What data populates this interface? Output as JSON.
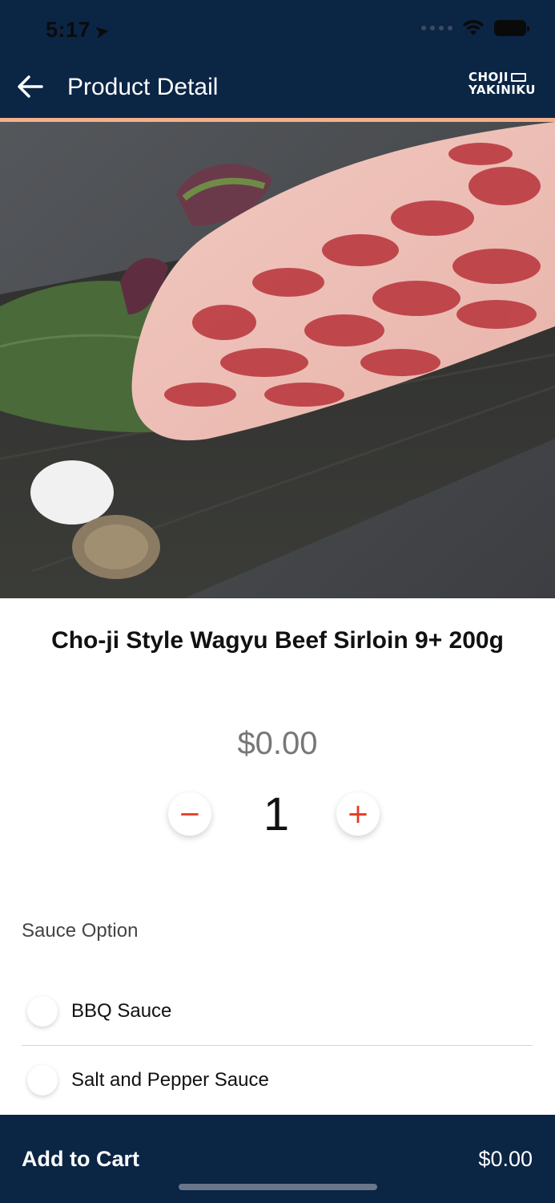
{
  "status_bar": {
    "time": "5:17"
  },
  "header": {
    "title": "Product Detail",
    "brand_line1": "CHOJI",
    "brand_line2": "YAKINIKU"
  },
  "colors": {
    "navy": "#0b2544",
    "accent": "#f4b08c",
    "stepper_red": "#e23b22"
  },
  "product": {
    "image_icon": "product-photo",
    "name": "Cho-ji Style Wagyu Beef Sirloin 9+ 200g",
    "price": "$0.00",
    "quantity": "1",
    "minus_symbol": "−",
    "plus_symbol": "+"
  },
  "sauce": {
    "label": "Sauce Option",
    "options": [
      {
        "label": "BBQ Sauce",
        "selected": false
      },
      {
        "label": "Salt and Pepper Sauce",
        "selected": false
      }
    ]
  },
  "cart": {
    "label": "Add to Cart",
    "total": "$0.00"
  }
}
